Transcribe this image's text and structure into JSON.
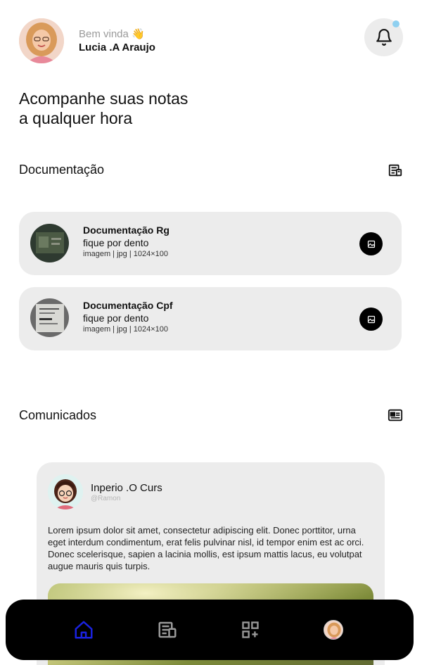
{
  "header": {
    "greeting": "Bem vinda 👋",
    "user_name": "Lucia .A Araujo",
    "notification_dot_color": "#8fd0f0"
  },
  "hero": {
    "line1": "Acompanhe suas notas",
    "line2": "a qualquer hora"
  },
  "documents": {
    "section_title": "Documentação",
    "section_icon": "document-list-icon",
    "items": [
      {
        "title": "Documentação Rg",
        "subtitle": "fique por dento",
        "meta": "imagem | jpg | 1024×100",
        "action_icon": "image-icon"
      },
      {
        "title": "Documentação Cpf",
        "subtitle": "fique por dento",
        "meta": "imagem | jpg | 1024×100",
        "action_icon": "image-icon"
      }
    ]
  },
  "announcements": {
    "section_title": "Comunicados",
    "section_icon": "newspaper-icon",
    "post": {
      "author": "Inperio .O Curs",
      "handle": "@Ramon",
      "body": "Lorem ipsum dolor sit amet, consectetur adipiscing elit. Donec porttitor, urna eget interdum condimentum, erat felis pulvinar nisl, id tempor enim est ac orci. Donec scelerisque, sapien a lacinia mollis, est ipsum mattis lacus, eu volutpat augue mauris quis turpis."
    }
  },
  "navbar": {
    "items": [
      "home-icon",
      "document-list-icon",
      "apps-add-icon",
      "profile-avatar"
    ],
    "active": "home-icon",
    "active_color": "#1a22e0",
    "inactive_color": "#9a9a9a"
  }
}
